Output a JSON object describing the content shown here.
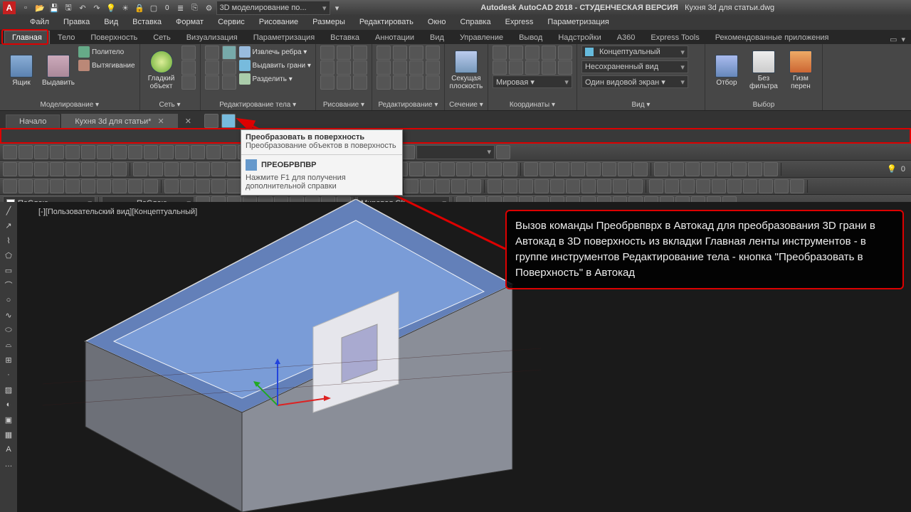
{
  "title_prefix": "Autodesk AutoCAD 2018 - СТУДЕНЧЕСКАЯ ВЕРСИЯ",
  "title_file": "Кухня 3d для статьи.dwg",
  "workspace": "3D моделирование по...",
  "menu": [
    "Файл",
    "Правка",
    "Вид",
    "Вставка",
    "Формат",
    "Сервис",
    "Рисование",
    "Размеры",
    "Редактировать",
    "Окно",
    "Справка",
    "Express",
    "Параметризация"
  ],
  "ribbon_tabs": [
    "Главная",
    "Тело",
    "Поверхность",
    "Сеть",
    "Визуализация",
    "Параметризация",
    "Вставка",
    "Аннотации",
    "Вид",
    "Управление",
    "Вывод",
    "Надстройки",
    "A360",
    "Express Tools",
    "Рекомендованные приложения"
  ],
  "ribbon_active": "Главная",
  "panels": {
    "model": {
      "title": "Моделирование ▾",
      "big": [
        {
          "l": "Ящик"
        },
        {
          "l": "Выдавить"
        }
      ],
      "rows": [
        {
          "l": "Политело"
        },
        {
          "l": "Вытягивание"
        }
      ]
    },
    "mesh": {
      "title": "Сеть ▾",
      "big": [
        {
          "l": "Гладкий\nобъект"
        }
      ]
    },
    "solid_edit": {
      "title": "Редактирование тела ▾",
      "rows": [
        {
          "l": "Извлечь ребра ▾"
        },
        {
          "l": "Выдавить грани ▾"
        },
        {
          "l": "Разделить ▾"
        }
      ]
    },
    "draw": {
      "title": "Рисование ▾"
    },
    "edit": {
      "title": "Редактирование ▾"
    },
    "section": {
      "title": "Сечение ▾",
      "big": [
        {
          "l": "Секущая\nплоскость"
        }
      ]
    },
    "coord": {
      "title": "Координаты ▾",
      "ddl": "Мировая ▾"
    },
    "view": {
      "title": "Вид ▾",
      "dd": [
        "Концептуальный",
        "Несохраненный вид",
        "Один видовой экран ▾"
      ]
    },
    "select": {
      "title": "Выбор",
      "big": [
        {
          "l": "Отбор"
        },
        {
          "l": "Без фильтра"
        },
        {
          "l": "Гизм\nперен"
        }
      ]
    }
  },
  "file_tabs": [
    {
      "l": "Начало",
      "a": false
    },
    {
      "l": "Кухня 3d для статьи*",
      "a": true
    }
  ],
  "layer_combo": "ПоСлою",
  "linetype_combo": "ПоСлою",
  "ucs_combo": "Мировая СК",
  "vptag": "[-][Пользовательский вид][Концептуальный]",
  "tooltip": {
    "title": "Преобразовать в поверхность",
    "sub": "Преобразование объектов в поверхность",
    "cmd": "ПРЕОБРВПВР",
    "help": "Нажмите F1 для получения дополнительной справки"
  },
  "callout": "Вызов команды Преобрвпврх в Автокад для преобразования 3D грани в Автокад в 3D поверхность из вкладки Главная ленты инструментов - в группе инструментов Редактирование тела - кнопка \"Преобразовать в Поверхность\" в Автокад"
}
